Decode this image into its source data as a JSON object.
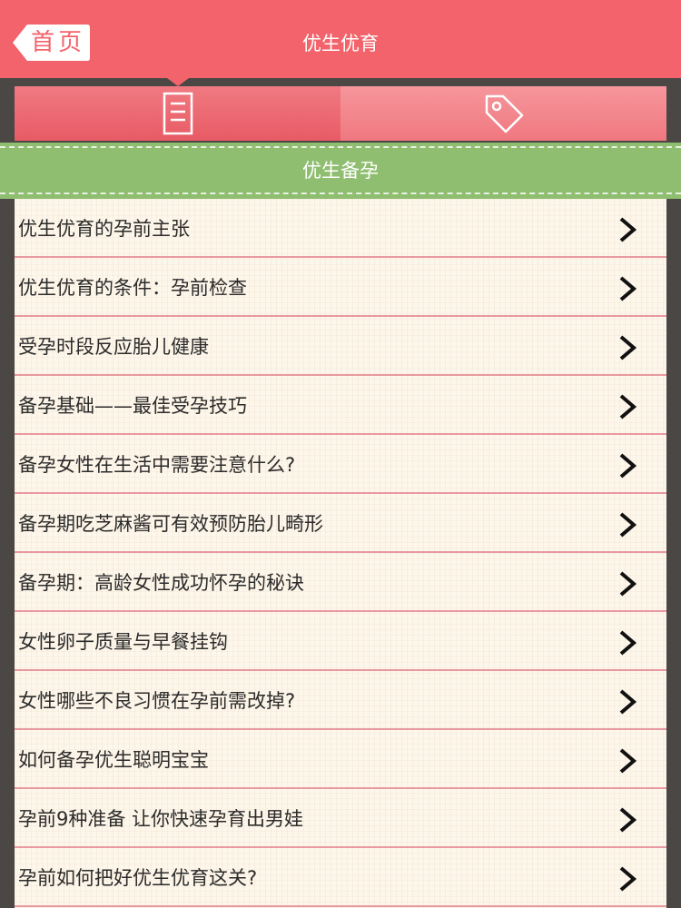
{
  "header": {
    "back_label": "首页",
    "title": "优生优育"
  },
  "tabs": [
    {
      "icon": "document-icon",
      "selected": true
    },
    {
      "icon": "tag-icon",
      "selected": false
    }
  ],
  "section": {
    "title": "优生备孕"
  },
  "list": {
    "items": [
      "优生优育的孕前主张",
      "优生优育的条件：孕前检查",
      "受孕时段反应胎儿健康",
      "备孕基础——最佳受孕技巧",
      "备孕女性在生活中需要注意什么?",
      "备孕期吃芝麻酱可有效预防胎儿畸形",
      "备孕期：高龄女性成功怀孕的秘诀",
      "女性卵子质量与早餐挂钩",
      "女性哪些不良习惯在孕前需改掉?",
      "如何备孕优生聪明宝宝",
      "孕前9种准备 让你快速孕育出男娃",
      "孕前如何把好优生优育这关?"
    ]
  },
  "colors": {
    "header_red": "#f3636b",
    "banner_green": "#8fbe70",
    "list_background": "#fdf6ea",
    "divider_pink": "#e89aa0"
  }
}
